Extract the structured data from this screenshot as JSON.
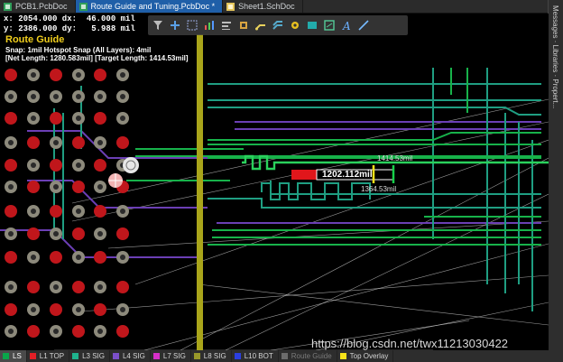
{
  "tabs": [
    {
      "label": "PCB1.PcbDoc",
      "active": false,
      "icon": "pcb-doc-icon"
    },
    {
      "label": "Route Guide and Tuning.PcbDoc *",
      "active": true,
      "icon": "pcb-doc-icon"
    },
    {
      "label": "Sheet1.SchDoc",
      "active": false,
      "icon": "sch-doc-icon"
    }
  ],
  "side_panel": {
    "label": "Messages · Libraries · Propert..."
  },
  "hud": {
    "row1": "x: 2054.000 dx:  46.000 mil",
    "row2": "y: 2386.000 dy:   5.988 mil"
  },
  "route_guide": {
    "title": "Route Guide",
    "snap": "Snap: 1mil Hotspot Snap (All Layers): 4mil",
    "lengths": "[Net Length: 1280.583mil] [Target Length: 1414.53mil]"
  },
  "toolbar": {
    "tools": [
      "filter-icon",
      "add-icon",
      "select-rect-icon",
      "chart-icon",
      "align-icon",
      "place-component-icon",
      "route-icon",
      "drill-icon",
      "via-icon",
      "shape-icon",
      "dimension-icon",
      "text-icon",
      "line-icon"
    ]
  },
  "tuning": {
    "current_length": "1202.112mil",
    "max_length": "1414.53mil",
    "min_length": "1364.53mil"
  },
  "watermark": "https://blog.csdn.net/twx11213030422",
  "layers": [
    {
      "label": "LS",
      "color": "#0aa64a",
      "active": true
    },
    {
      "label": "L1 TOP",
      "color": "#e21f26",
      "active": false
    },
    {
      "label": "L3 SIG",
      "color": "#1fb38d",
      "active": false
    },
    {
      "label": "L4 SIG",
      "color": "#7b4fc9",
      "active": false
    },
    {
      "label": "L7 SIG",
      "color": "#d62fc8",
      "active": false
    },
    {
      "label": "L8 SIG",
      "color": "#98982a",
      "active": false
    },
    {
      "label": "L10 BOT",
      "color": "#2b3fe0",
      "active": false
    },
    {
      "label": "Route Guide",
      "color": "#6b6b6b",
      "active": false,
      "dim": true
    },
    {
      "label": "Top Overlay",
      "color": "#f6e21a",
      "active": false
    }
  ],
  "colors": {
    "background": "#000000",
    "track_green": "#17b24a",
    "track_teal": "#1f9e82",
    "track_purple": "#6b3fb5",
    "pad_red": "#c0161b",
    "olive": "#a9a51a"
  }
}
